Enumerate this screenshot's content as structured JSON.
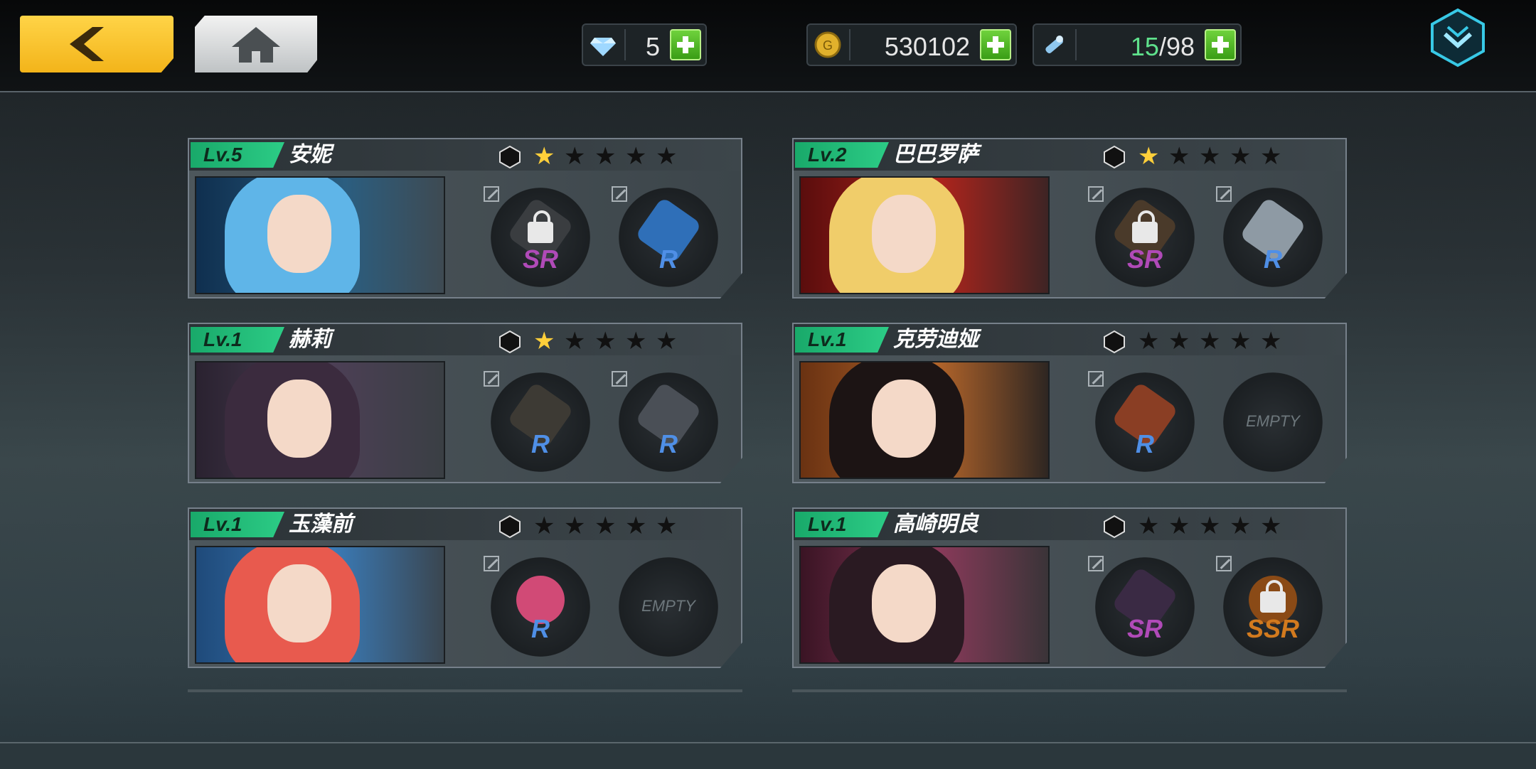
{
  "topbar": {
    "back_icon": "chevron-left-icon",
    "home_icon": "home-icon",
    "resources": [
      {
        "icon": "diamond-icon",
        "value": "5"
      },
      {
        "icon": "gold-coin-icon",
        "value": "530102"
      },
      {
        "icon": "stamina-vial-icon",
        "current": "15",
        "max": "/98"
      }
    ],
    "menu_icon": "collapse-chevron-icon"
  },
  "cards": [
    {
      "level": "Lv.5",
      "name": "安妮",
      "stars": 1,
      "equip": [
        {
          "rank": "SR",
          "locked": true,
          "empty": false
        },
        {
          "rank": "R",
          "locked": false,
          "empty": false
        }
      ]
    },
    {
      "level": "Lv.2",
      "name": "巴巴罗萨",
      "stars": 1,
      "equip": [
        {
          "rank": "SR",
          "locked": true,
          "empty": false
        },
        {
          "rank": "R",
          "locked": false,
          "empty": false
        }
      ]
    },
    {
      "level": "Lv.1",
      "name": "赫莉",
      "stars": 1,
      "equip": [
        {
          "rank": "R",
          "locked": false,
          "empty": false
        },
        {
          "rank": "R",
          "locked": false,
          "empty": false
        }
      ]
    },
    {
      "level": "Lv.1",
      "name": "克劳迪娅",
      "stars": 0,
      "equip": [
        {
          "rank": "R",
          "locked": false,
          "empty": false
        },
        {
          "rank": "",
          "label": "EMPTY",
          "locked": false,
          "empty": true
        }
      ]
    },
    {
      "level": "Lv.1",
      "name": "玉藻前",
      "stars": 0,
      "equip": [
        {
          "rank": "R",
          "locked": false,
          "empty": false
        },
        {
          "rank": "",
          "label": "EMPTY",
          "locked": false,
          "empty": true
        }
      ]
    },
    {
      "level": "Lv.1",
      "name": "高崎明良",
      "stars": 0,
      "equip": [
        {
          "rank": "SR",
          "locked": false,
          "empty": false
        },
        {
          "rank": "SSR",
          "locked": true,
          "empty": false
        }
      ]
    }
  ],
  "colors": {
    "accent_green": "#2ccc86",
    "gold": "#ffcf3a",
    "rank_r": "#4f8fe6",
    "rank_sr": "#b04ab8",
    "rank_ssr": "#d27a1e"
  }
}
